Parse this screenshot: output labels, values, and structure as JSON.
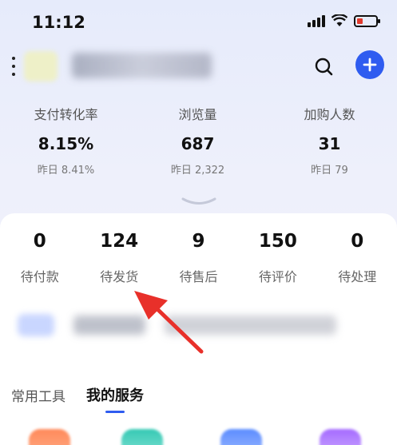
{
  "status_bar": {
    "time": "11:12"
  },
  "header": {
    "search_icon": "search-icon",
    "add_icon": "plus-icon",
    "more_icon": "more-vertical-icon"
  },
  "stats": [
    {
      "label": "支付转化率",
      "value": "8.15%",
      "prev": "昨日 8.41%"
    },
    {
      "label": "浏览量",
      "value": "687",
      "prev": "昨日 2,322"
    },
    {
      "label": "加购人数",
      "value": "31",
      "prev": "昨日 79"
    }
  ],
  "orders": [
    {
      "value": "0",
      "label": "待付款"
    },
    {
      "value": "124",
      "label": "待发货"
    },
    {
      "value": "9",
      "label": "待售后"
    },
    {
      "value": "150",
      "label": "待评价"
    },
    {
      "value": "0",
      "label": "待处理"
    }
  ],
  "tabs": [
    {
      "label": "常用工具",
      "active": false
    },
    {
      "label": "我的服务",
      "active": true
    }
  ],
  "colors": {
    "accent": "#2f5cf0",
    "arrow": "#e8302a"
  }
}
